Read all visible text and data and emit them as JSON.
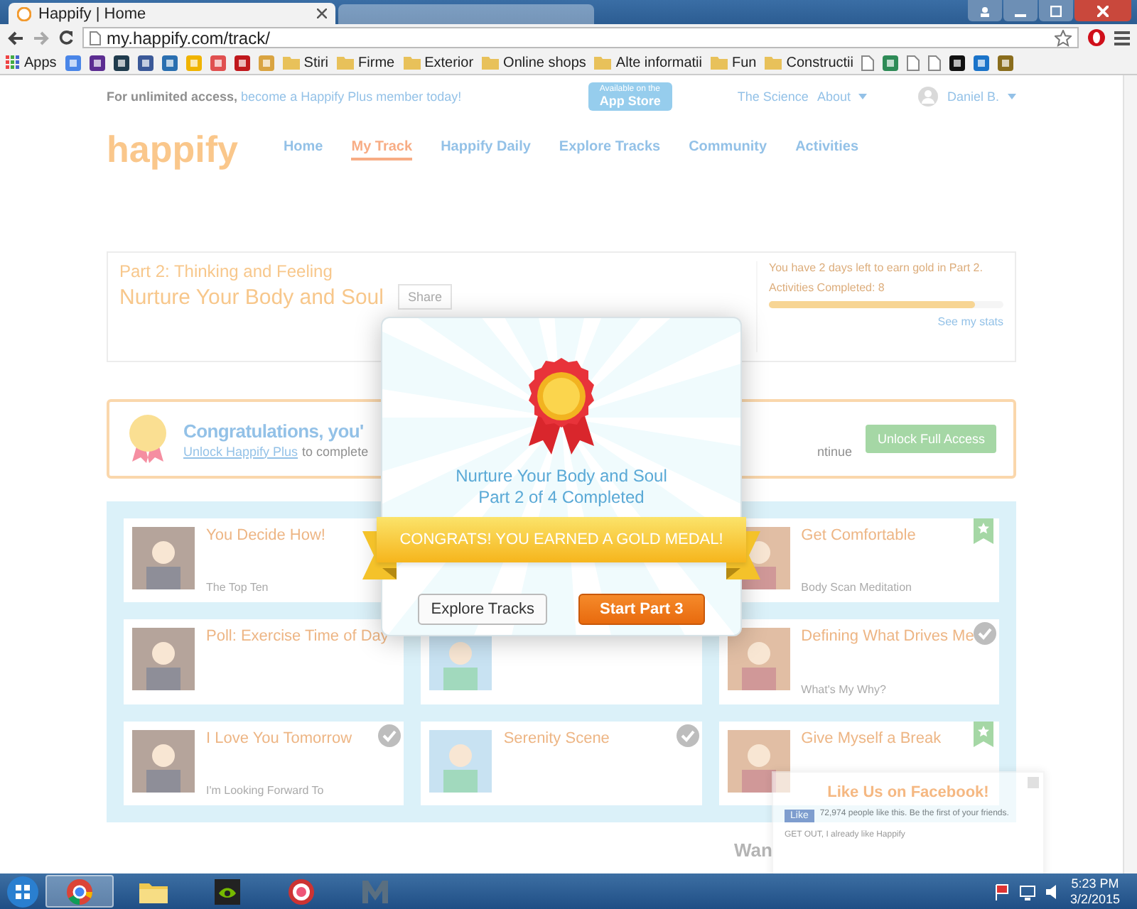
{
  "browser": {
    "tab_title": "Happify | Home",
    "address": "my.happify.com/track/",
    "bookmarks": [
      {
        "kind": "apps",
        "label": "Apps"
      },
      {
        "kind": "site",
        "color": "#4a86e8"
      },
      {
        "kind": "site",
        "color": "#5c2d91"
      },
      {
        "kind": "site",
        "color": "#1f3b4d"
      },
      {
        "kind": "site",
        "color": "#3b5998"
      },
      {
        "kind": "site",
        "color": "#2a6fb0"
      },
      {
        "kind": "site",
        "color": "#f0b400"
      },
      {
        "kind": "site",
        "color": "#e05050"
      },
      {
        "kind": "site",
        "color": "#c0181d"
      },
      {
        "kind": "site",
        "color": "#d9a441"
      },
      {
        "kind": "folder",
        "label": "Stiri"
      },
      {
        "kind": "folder",
        "label": "Firme"
      },
      {
        "kind": "folder",
        "label": "Exterior"
      },
      {
        "kind": "folder",
        "label": "Online shops"
      },
      {
        "kind": "folder",
        "label": "Alte informatii"
      },
      {
        "kind": "folder",
        "label": "Fun"
      },
      {
        "kind": "folder",
        "label": "Constructii"
      },
      {
        "kind": "page"
      },
      {
        "kind": "site",
        "color": "#2e8b57"
      },
      {
        "kind": "page"
      },
      {
        "kind": "page"
      },
      {
        "kind": "site",
        "color": "#111111"
      },
      {
        "kind": "site",
        "color": "#1a73c9"
      },
      {
        "kind": "site",
        "color": "#8a6d1d"
      }
    ]
  },
  "topbar": {
    "lead": "For unlimited access,",
    "link": "become a Happify Plus member today!",
    "store_small": "Available on the",
    "store_big": "App Store",
    "science": "The Science",
    "about": "About",
    "user": "Daniel B."
  },
  "nav": {
    "logo": "happify",
    "items": [
      {
        "label": "Home",
        "selected": false
      },
      {
        "label": "My Track",
        "selected": true
      },
      {
        "label": "Happify Daily",
        "selected": false
      },
      {
        "label": "Explore Tracks",
        "selected": false
      },
      {
        "label": "Community",
        "selected": false
      },
      {
        "label": "Activities",
        "selected": false
      }
    ]
  },
  "track": {
    "part": "Part 2: Thinking and Feeling",
    "title": "Nurture Your Body and Soul",
    "share": "Share",
    "days_left": "You have 2 days left to earn gold in Part 2.",
    "completed": "Activities Completed: 8",
    "level": 0.88,
    "stats": "See my stats"
  },
  "congrats": {
    "title": "Congratulations, you'",
    "link": "Unlock Happify Plus",
    "text": "to complete",
    "tail": "ntinue",
    "button": "Unlock Full Access"
  },
  "cards": [
    {
      "kind": "activity",
      "title": "You Decide How!",
      "subtitle": "The Top Ten"
    },
    {
      "kind": "hidden"
    },
    {
      "kind": "activity",
      "title": "Get Comfortable",
      "subtitle": "Body Scan Meditation",
      "starred": true
    },
    {
      "kind": "activity",
      "title": "Poll: Exercise Time of Day"
    },
    {
      "kind": "covered"
    },
    {
      "kind": "activity",
      "title": "Defining What Drives Me",
      "subtitle": "What's My Why?",
      "done": true
    },
    {
      "kind": "activity",
      "title": "I Love You Tomorrow",
      "subtitle": "I'm Looking Forward To",
      "done": true
    },
    {
      "kind": "activity",
      "title": "Serenity Scene",
      "done": true
    },
    {
      "kind": "activity",
      "title": "Give Myself a Break",
      "starred": true
    }
  ],
  "footer_text": "Wan",
  "facebook": {
    "title": "Like Us on Facebook!",
    "like": "Like",
    "count": "72,974 people like this. Be the first of your friends.",
    "dismiss": "GET OUT, I already like Happify"
  },
  "modal": {
    "line1": "Nurture Your Body and Soul",
    "line2": "Part 2 of 4 Completed",
    "banner": "CONGRATS! YOU EARNED A GOLD MEDAL!",
    "secondary": "Explore Tracks",
    "primary": "Start Part 3"
  },
  "taskbar": {
    "apps": [
      {
        "kind": "chrome",
        "selected": true
      },
      {
        "kind": "folder",
        "selected": false
      },
      {
        "kind": "nvidia",
        "selected": false
      },
      {
        "kind": "badge",
        "selected": false
      },
      {
        "kind": "m",
        "selected": false
      }
    ],
    "time": "5:23 PM",
    "date": "3/2/2015"
  }
}
